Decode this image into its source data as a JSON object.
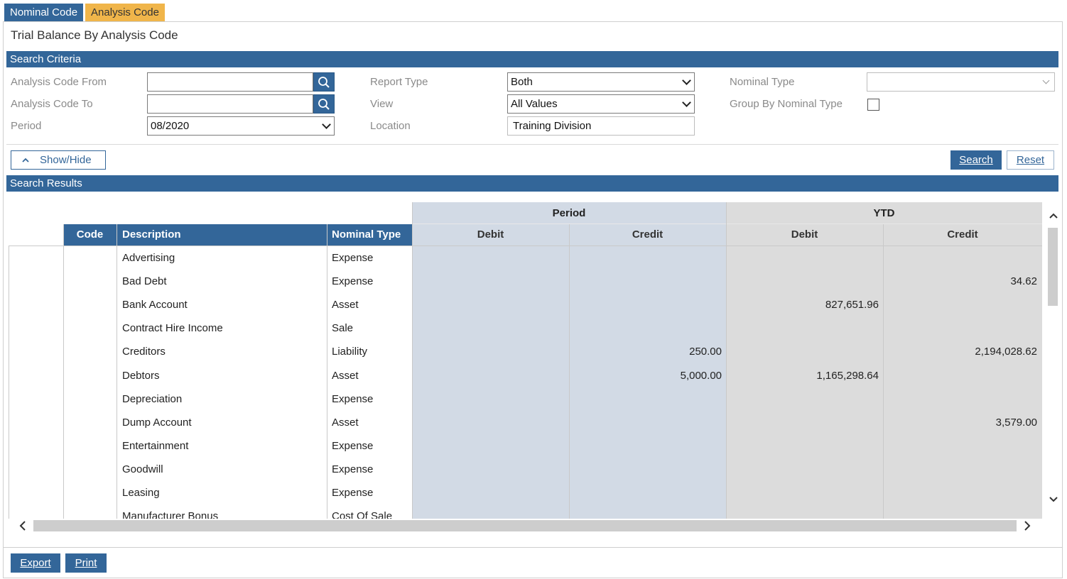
{
  "tabs": [
    {
      "label": "Nominal Code"
    },
    {
      "label": "Analysis Code"
    }
  ],
  "page_title": "Trial Balance By Analysis Code",
  "search_criteria": {
    "header": "Search Criteria",
    "analysis_code_from_label": "Analysis Code From",
    "analysis_code_from_value": "",
    "analysis_code_to_label": "Analysis Code To",
    "analysis_code_to_value": "",
    "period_label": "Period",
    "period_value": "08/2020",
    "report_type_label": "Report Type",
    "report_type_value": "Both",
    "view_label": "View",
    "view_value": "All Values",
    "location_label": "Location",
    "location_value": "Training Division",
    "nominal_type_label": "Nominal Type",
    "nominal_type_value": "",
    "group_by_label": "Group By Nominal Type",
    "group_by_checked": false
  },
  "toolbar": {
    "show_hide_label": "Show/Hide",
    "search_label": "Search",
    "reset_label": "Reset"
  },
  "results": {
    "header": "Search Results",
    "group_headers": {
      "period": "Period",
      "ytd": "YTD"
    },
    "columns": {
      "code": "Code",
      "description": "Description",
      "nominal_type": "Nominal Type",
      "period_debit": "Debit",
      "period_credit": "Credit",
      "ytd_debit": "Debit",
      "ytd_credit": "Credit"
    },
    "rows": [
      {
        "code": "",
        "description": "Advertising",
        "nominal_type": "Expense",
        "period_debit": "",
        "period_credit": "",
        "ytd_debit": "",
        "ytd_credit": ""
      },
      {
        "code": "",
        "description": "Bad Debt",
        "nominal_type": "Expense",
        "period_debit": "",
        "period_credit": "",
        "ytd_debit": "",
        "ytd_credit": "34.62"
      },
      {
        "code": "",
        "description": "Bank Account",
        "nominal_type": "Asset",
        "period_debit": "",
        "period_credit": "",
        "ytd_debit": "827,651.96",
        "ytd_credit": ""
      },
      {
        "code": "",
        "description": "Contract Hire Income",
        "nominal_type": "Sale",
        "period_debit": "",
        "period_credit": "",
        "ytd_debit": "",
        "ytd_credit": ""
      },
      {
        "code": "",
        "description": "Creditors",
        "nominal_type": "Liability",
        "period_debit": "",
        "period_credit": "250.00",
        "ytd_debit": "",
        "ytd_credit": "2,194,028.62"
      },
      {
        "code": "",
        "description": "Debtors",
        "nominal_type": "Asset",
        "period_debit": "",
        "period_credit": "5,000.00",
        "ytd_debit": "1,165,298.64",
        "ytd_credit": ""
      },
      {
        "code": "",
        "description": "Depreciation",
        "nominal_type": "Expense",
        "period_debit": "",
        "period_credit": "",
        "ytd_debit": "",
        "ytd_credit": ""
      },
      {
        "code": "",
        "description": "Dump Account",
        "nominal_type": "Asset",
        "period_debit": "",
        "period_credit": "",
        "ytd_debit": "",
        "ytd_credit": "3,579.00"
      },
      {
        "code": "",
        "description": "Entertainment",
        "nominal_type": "Expense",
        "period_debit": "",
        "period_credit": "",
        "ytd_debit": "",
        "ytd_credit": ""
      },
      {
        "code": "",
        "description": "Goodwill",
        "nominal_type": "Expense",
        "period_debit": "",
        "period_credit": "",
        "ytd_debit": "",
        "ytd_credit": ""
      },
      {
        "code": "",
        "description": "Leasing",
        "nominal_type": "Expense",
        "period_debit": "",
        "period_credit": "",
        "ytd_debit": "",
        "ytd_credit": ""
      },
      {
        "code": "",
        "description": "Manufacturer Bonus",
        "nominal_type": "Cost Of Sale",
        "period_debit": "",
        "period_credit": "",
        "ytd_debit": "",
        "ytd_credit": ""
      }
    ]
  },
  "footer": {
    "export_label": "Export",
    "print_label": "Print"
  },
  "colors": {
    "primary_blue": "#336699",
    "tab_orange": "#f0b54a",
    "period_band": "#d2dae5",
    "ytd_band": "#dcdcdc"
  }
}
